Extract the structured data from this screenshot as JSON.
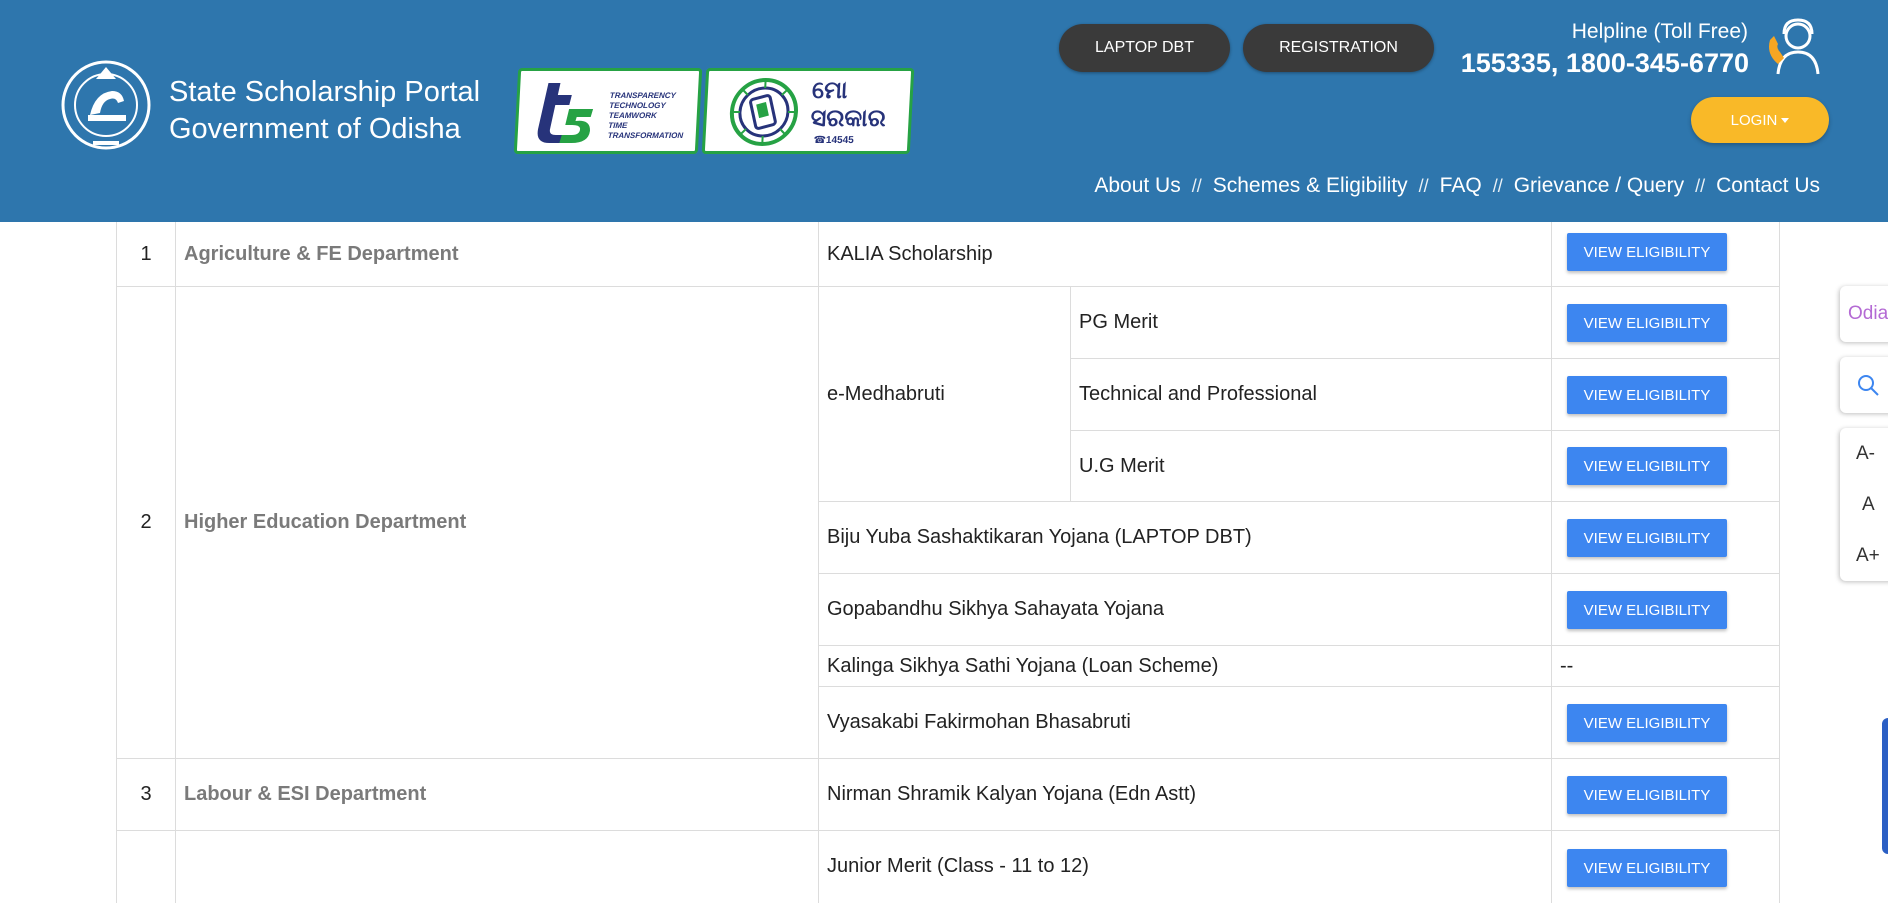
{
  "header": {
    "title_line1": "State Scholarship Portal",
    "title_line2": "Government of Odisha",
    "laptop_btn": "LAPTOP DBT",
    "registration_btn": "REGISTRATION",
    "helpline_label": "Helpline (Toll Free)",
    "helpline_number": "155335, 1800-345-6770",
    "login_btn": "LOGIN",
    "logo_t5_words": [
      "TRANSPARENCY",
      "TECHNOLOGY",
      "TEAMWORK",
      "TIME",
      "TRANSFORMATION"
    ],
    "logo_mo_text1": "ମୋ",
    "logo_mo_text2": "ସରକାର",
    "logo_mo_number": "☎14545",
    "nav": [
      "About Us",
      "Schemes & Eligibility",
      "FAQ",
      "Grievance / Query",
      "Contact Us"
    ],
    "nav_separator": "//"
  },
  "colors": {
    "header_bg": "#2e76ad",
    "pill_btn": "#3a3a3a",
    "login_btn": "#f9b928",
    "view_btn": "#3d86f0",
    "dept_text": "#7a7a7a"
  },
  "table": {
    "button_label": "VIEW ELIGIBILITY",
    "no_action": "--",
    "rows": [
      {
        "no": "1",
        "department": "Agriculture & FE Department"
      },
      {
        "no": "2",
        "department": "Higher Education Department"
      },
      {
        "no": "3",
        "department": "Labour & ESI Department"
      },
      {
        "no": "",
        "department": ""
      }
    ],
    "schemes": {
      "kalia": "KALIA Scholarship",
      "emedhabruti": "e-Medhabruti",
      "pg_merit": "PG Merit",
      "tech_prof": "Technical and Professional",
      "ug_merit": "U.G Merit",
      "biju_yuba": "Biju Yuba Sashaktikaran Yojana (LAPTOP DBT)",
      "gopabandhu": "Gopabandhu Sikhya Sahayata Yojana",
      "kalinga": "Kalinga Sikhya Sathi Yojana (Loan Scheme)",
      "vyasakabi": "Vyasakabi Fakirmohan Bhasabruti",
      "nirman": "Nirman Shramik Kalyan Yojana (Edn Astt)",
      "junior_merit": "Junior Merit (Class - 11 to 12)"
    }
  },
  "side_widgets": {
    "language": "Odia",
    "font_decrease": "A-",
    "font_normal": "A",
    "font_increase": "A+"
  }
}
